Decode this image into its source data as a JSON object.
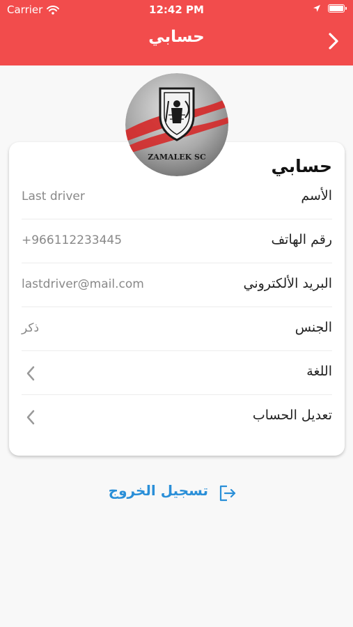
{
  "status_bar": {
    "carrier": "Carrier",
    "time": "12:42 PM"
  },
  "nav": {
    "title": "حسابي",
    "back_icon": "chevron-right-icon"
  },
  "avatar": {
    "logo_text": "ZAMALEK SC"
  },
  "card": {
    "title": "حسابي",
    "rows": [
      {
        "label": "الأسم",
        "value": "Last driver"
      },
      {
        "label": "رقم الهاتف",
        "value": "+966112233445"
      },
      {
        "label": "البريد الألكتروني",
        "value": "lastdriver@mail.com"
      },
      {
        "label": "الجنس",
        "value": "ذكر"
      },
      {
        "label": "اللغة",
        "value": ""
      },
      {
        "label": "تعديل الحساب",
        "value": ""
      }
    ]
  },
  "logout": {
    "label": "تسجيل الخروج",
    "icon": "logout-icon"
  },
  "colors": {
    "header": "#f24c4c",
    "link": "#2a8fd8"
  }
}
